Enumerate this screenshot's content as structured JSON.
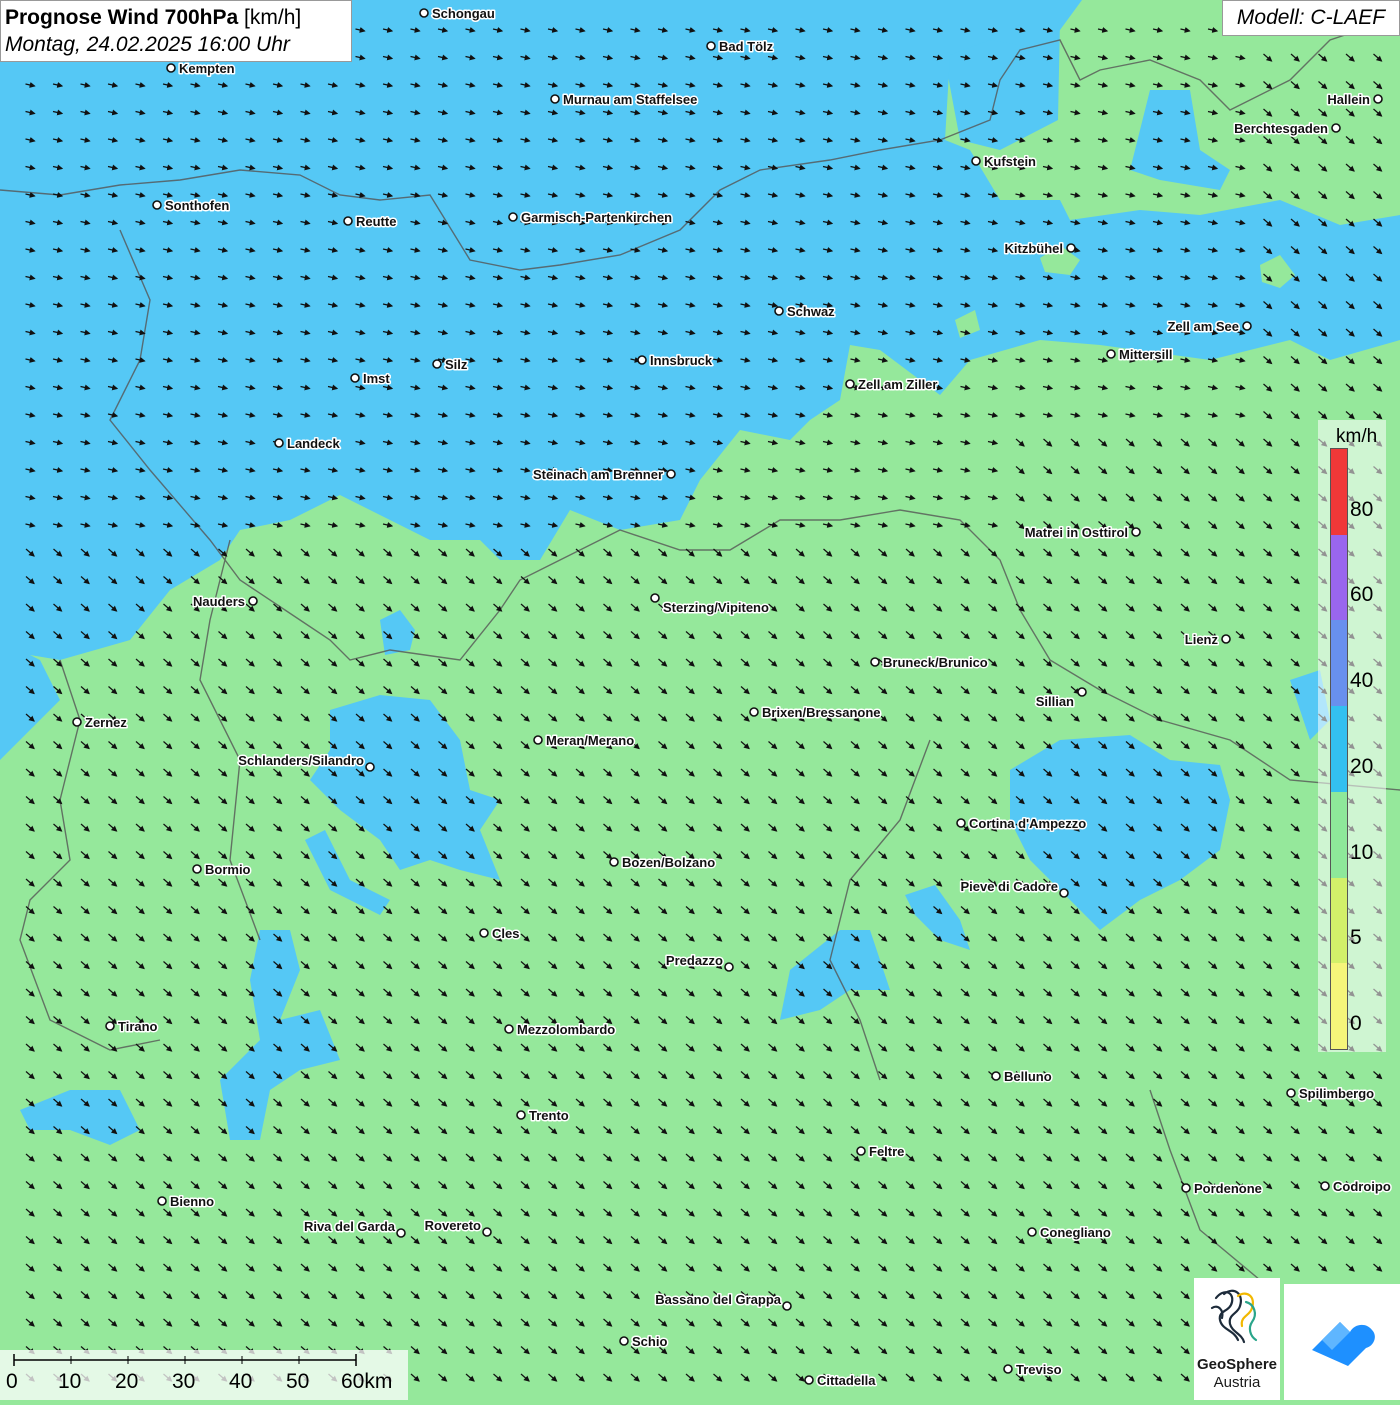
{
  "title": {
    "main": "Prognose Wind 700hPa",
    "unit": "[km/h]",
    "date": "Montag, 24.02.2025 16:00 Uhr"
  },
  "model": "Modell: C-LAEF",
  "colors": {
    "wind_0_10": "#95e89b",
    "wind_10_20": "#7de08c",
    "wind_20_40": "#55c8f5",
    "wind_40_60": "#6890ee",
    "wind_60_80": "#9966ee",
    "wind_80_plus": "#f03838",
    "wind_low": "#f5f57a",
    "wind_5": "#d2f06a",
    "arrow": "#111111",
    "border": "#555555"
  },
  "legend": {
    "unit": "km/h",
    "stops": [
      {
        "label": "80",
        "color": "#f03838"
      },
      {
        "label": "60",
        "color": "#9966ee"
      },
      {
        "label": "40",
        "color": "#6890ee"
      },
      {
        "label": "20",
        "color": "#33c0f0"
      },
      {
        "label": "10",
        "color": "#8ee89a"
      },
      {
        "label": "5",
        "color": "#d2f06a"
      },
      {
        "label": "0",
        "color": "#f5f57a"
      }
    ]
  },
  "scale": {
    "labels": [
      "0",
      "10",
      "20",
      "30",
      "40",
      "50",
      "60km"
    ]
  },
  "logo": {
    "name_line1": "GeoSphere",
    "name_line2": "Austria",
    "icon": "geosphere-logo-icon",
    "app_icon": "wetter-app-icon"
  },
  "wind_direction": "north-west",
  "cities": [
    {
      "name": "Schongau"
    },
    {
      "name": "Bad Tölz"
    },
    {
      "name": "Kempten"
    },
    {
      "name": "Murnau am Staffelsee"
    },
    {
      "name": "Hallein"
    },
    {
      "name": "Berchtesgaden"
    },
    {
      "name": "Kufstein"
    },
    {
      "name": "Sonthofen"
    },
    {
      "name": "Reutte"
    },
    {
      "name": "Garmisch-Partenkirchen"
    },
    {
      "name": "Kitzbühel"
    },
    {
      "name": "Schwaz"
    },
    {
      "name": "Zell am See"
    },
    {
      "name": "Mittersill"
    },
    {
      "name": "Innsbruck"
    },
    {
      "name": "Silz"
    },
    {
      "name": "Imst"
    },
    {
      "name": "Zell am Ziller"
    },
    {
      "name": "Landeck"
    },
    {
      "name": "Steinach am Brenner"
    },
    {
      "name": "Matrei in Osttirol"
    },
    {
      "name": "Nauders"
    },
    {
      "name": "Sterzing/Vipiteno"
    },
    {
      "name": "Lienz"
    },
    {
      "name": "Bruneck/Brunico"
    },
    {
      "name": "Sillian"
    },
    {
      "name": "Brixen/Bressanone"
    },
    {
      "name": "Zernez"
    },
    {
      "name": "Meran/Merano"
    },
    {
      "name": "Schlanders/Silandro"
    },
    {
      "name": "Cortina d'Ampezzo"
    },
    {
      "name": "Bozen/Bolzano"
    },
    {
      "name": "Bormio"
    },
    {
      "name": "Pieve di Cadore"
    },
    {
      "name": "Cles"
    },
    {
      "name": "Predazzo"
    },
    {
      "name": "Tirano"
    },
    {
      "name": "Mezzolombardo"
    },
    {
      "name": "Belluno"
    },
    {
      "name": "Spilimbergo"
    },
    {
      "name": "Trento"
    },
    {
      "name": "Feltre"
    },
    {
      "name": "Pordenone"
    },
    {
      "name": "Codroipo"
    },
    {
      "name": "Bienno"
    },
    {
      "name": "Riva del Garda"
    },
    {
      "name": "Rovereto"
    },
    {
      "name": "Conegliano"
    },
    {
      "name": "Bassano del Grappa"
    },
    {
      "name": "Schio"
    },
    {
      "name": "Treviso"
    },
    {
      "name": "Cittadella"
    }
  ]
}
